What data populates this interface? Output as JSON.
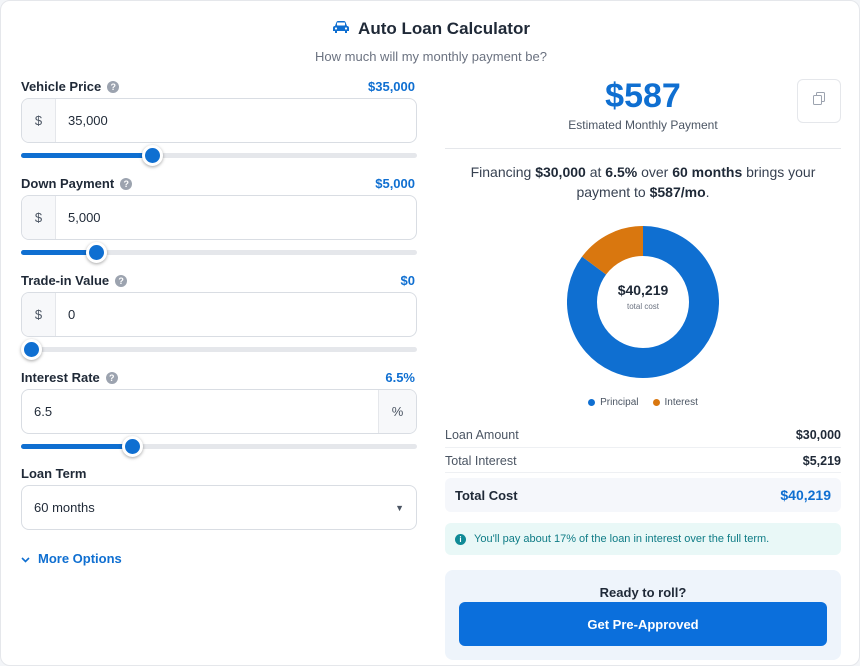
{
  "header": {
    "icon": "car-icon",
    "title": "Auto Loan Calculator",
    "subtitle": "How much will my monthly payment be?"
  },
  "fields": {
    "vehicle_price": {
      "label": "Vehicle Price",
      "display": "$35,000",
      "prefix": "$",
      "value": "35,000",
      "slider_fraction": 0.33
    },
    "down_payment": {
      "label": "Down Payment",
      "display": "$5,000",
      "prefix": "$",
      "value": "5,000",
      "slider_fraction": 0.19
    },
    "trade_in": {
      "label": "Trade-in Value",
      "display": "$0",
      "prefix": "$",
      "value": "0",
      "slider_fraction": 0.0
    },
    "interest_rate": {
      "label": "Interest Rate",
      "display": "6.5%",
      "value": "6.5",
      "suffix": "%",
      "slider_fraction": 0.28
    },
    "loan_term": {
      "label": "Loan Term",
      "selected": "60 months"
    }
  },
  "more_options": "More Options",
  "result": {
    "monthly_payment": "$587",
    "caption": "Estimated Monthly Payment",
    "summary": {
      "t1": "Financing ",
      "amount": "$30,000",
      "t2": " at ",
      "rate": "6.5%",
      "t3": " over ",
      "term": "60 months",
      "t4": " brings your payment to ",
      "payment": "$587/mo",
      "t5": "."
    }
  },
  "chart_data": {
    "type": "pie",
    "title": "",
    "center_value": "$40,219",
    "center_label": "total cost",
    "series": [
      {
        "name": "Principal",
        "value": 30000,
        "color": "#0f6fd1"
      },
      {
        "name": "Interest",
        "value": 5219,
        "color": "#d9770f"
      }
    ]
  },
  "breakdown": {
    "loan_amount_label": "Loan Amount",
    "loan_amount": "$30,000",
    "total_interest_label": "Total Interest",
    "total_interest": "$5,219",
    "total_cost_label": "Total Cost",
    "total_cost": "$40,219"
  },
  "info": "You'll pay about 17% of the loan in interest over the full term.",
  "cta": {
    "title": "Ready to roll?",
    "button": "Get Pre-Approved"
  },
  "colors": {
    "accent": "#0f6fd1",
    "interest": "#d9770f",
    "info_text": "#0f7c86"
  }
}
